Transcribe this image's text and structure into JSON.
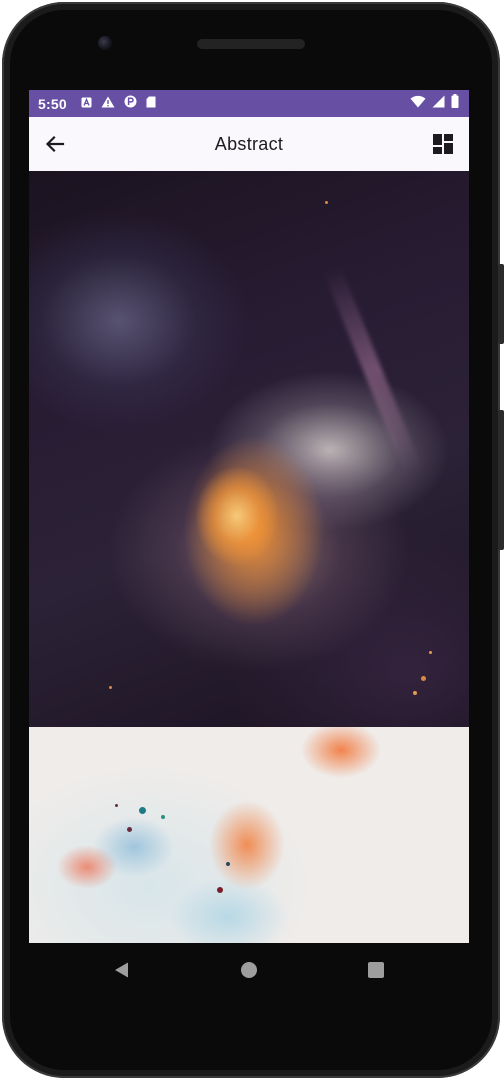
{
  "status_bar": {
    "time": "5:50",
    "left_icons": [
      "a-icon",
      "warning-icon",
      "p-icon",
      "sd-card-icon"
    ],
    "right_icons": [
      "wifi-icon",
      "signal-icon",
      "battery-icon"
    ],
    "color": "#6750a4"
  },
  "app_bar": {
    "title": "Abstract",
    "back_icon": "arrow-back-icon",
    "action_icon": "dashboard-layout-icon"
  },
  "gallery": {
    "images": [
      "abstract-fluid-art-dark-orange",
      "abstract-fluid-art-light-pastel"
    ]
  },
  "nav_bar": {
    "buttons": [
      "back-icon",
      "home-icon",
      "recents-icon"
    ]
  }
}
